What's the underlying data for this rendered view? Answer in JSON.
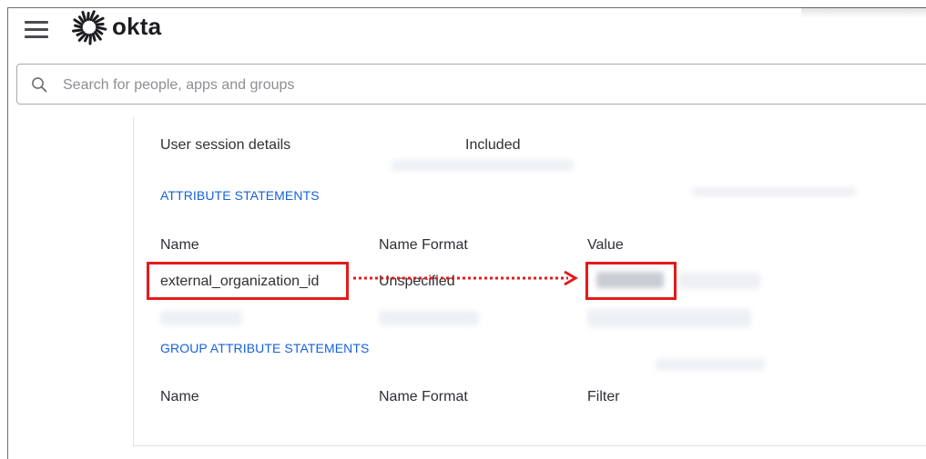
{
  "header": {
    "brand": "okta",
    "menu_icon": "hamburger-menu-icon",
    "logo_icon": "okta-sunburst-logo"
  },
  "search": {
    "placeholder": "Search for people, apps and groups",
    "value": ""
  },
  "session_row": {
    "label": "User session details",
    "value": "Included"
  },
  "attribute_statements": {
    "title": "ATTRIBUTE STATEMENTS",
    "columns": [
      "Name",
      "Name Format",
      "Value"
    ],
    "rows": [
      {
        "name": "external_organization_id",
        "format": "Unspecified"
      }
    ]
  },
  "group_attribute_statements": {
    "title": "GROUP ATTRIBUTE STATEMENTS",
    "columns": [
      "Name",
      "Name Format",
      "Filter"
    ]
  },
  "colors": {
    "accent": "#1662dd",
    "highlight": "#e31b1b"
  }
}
